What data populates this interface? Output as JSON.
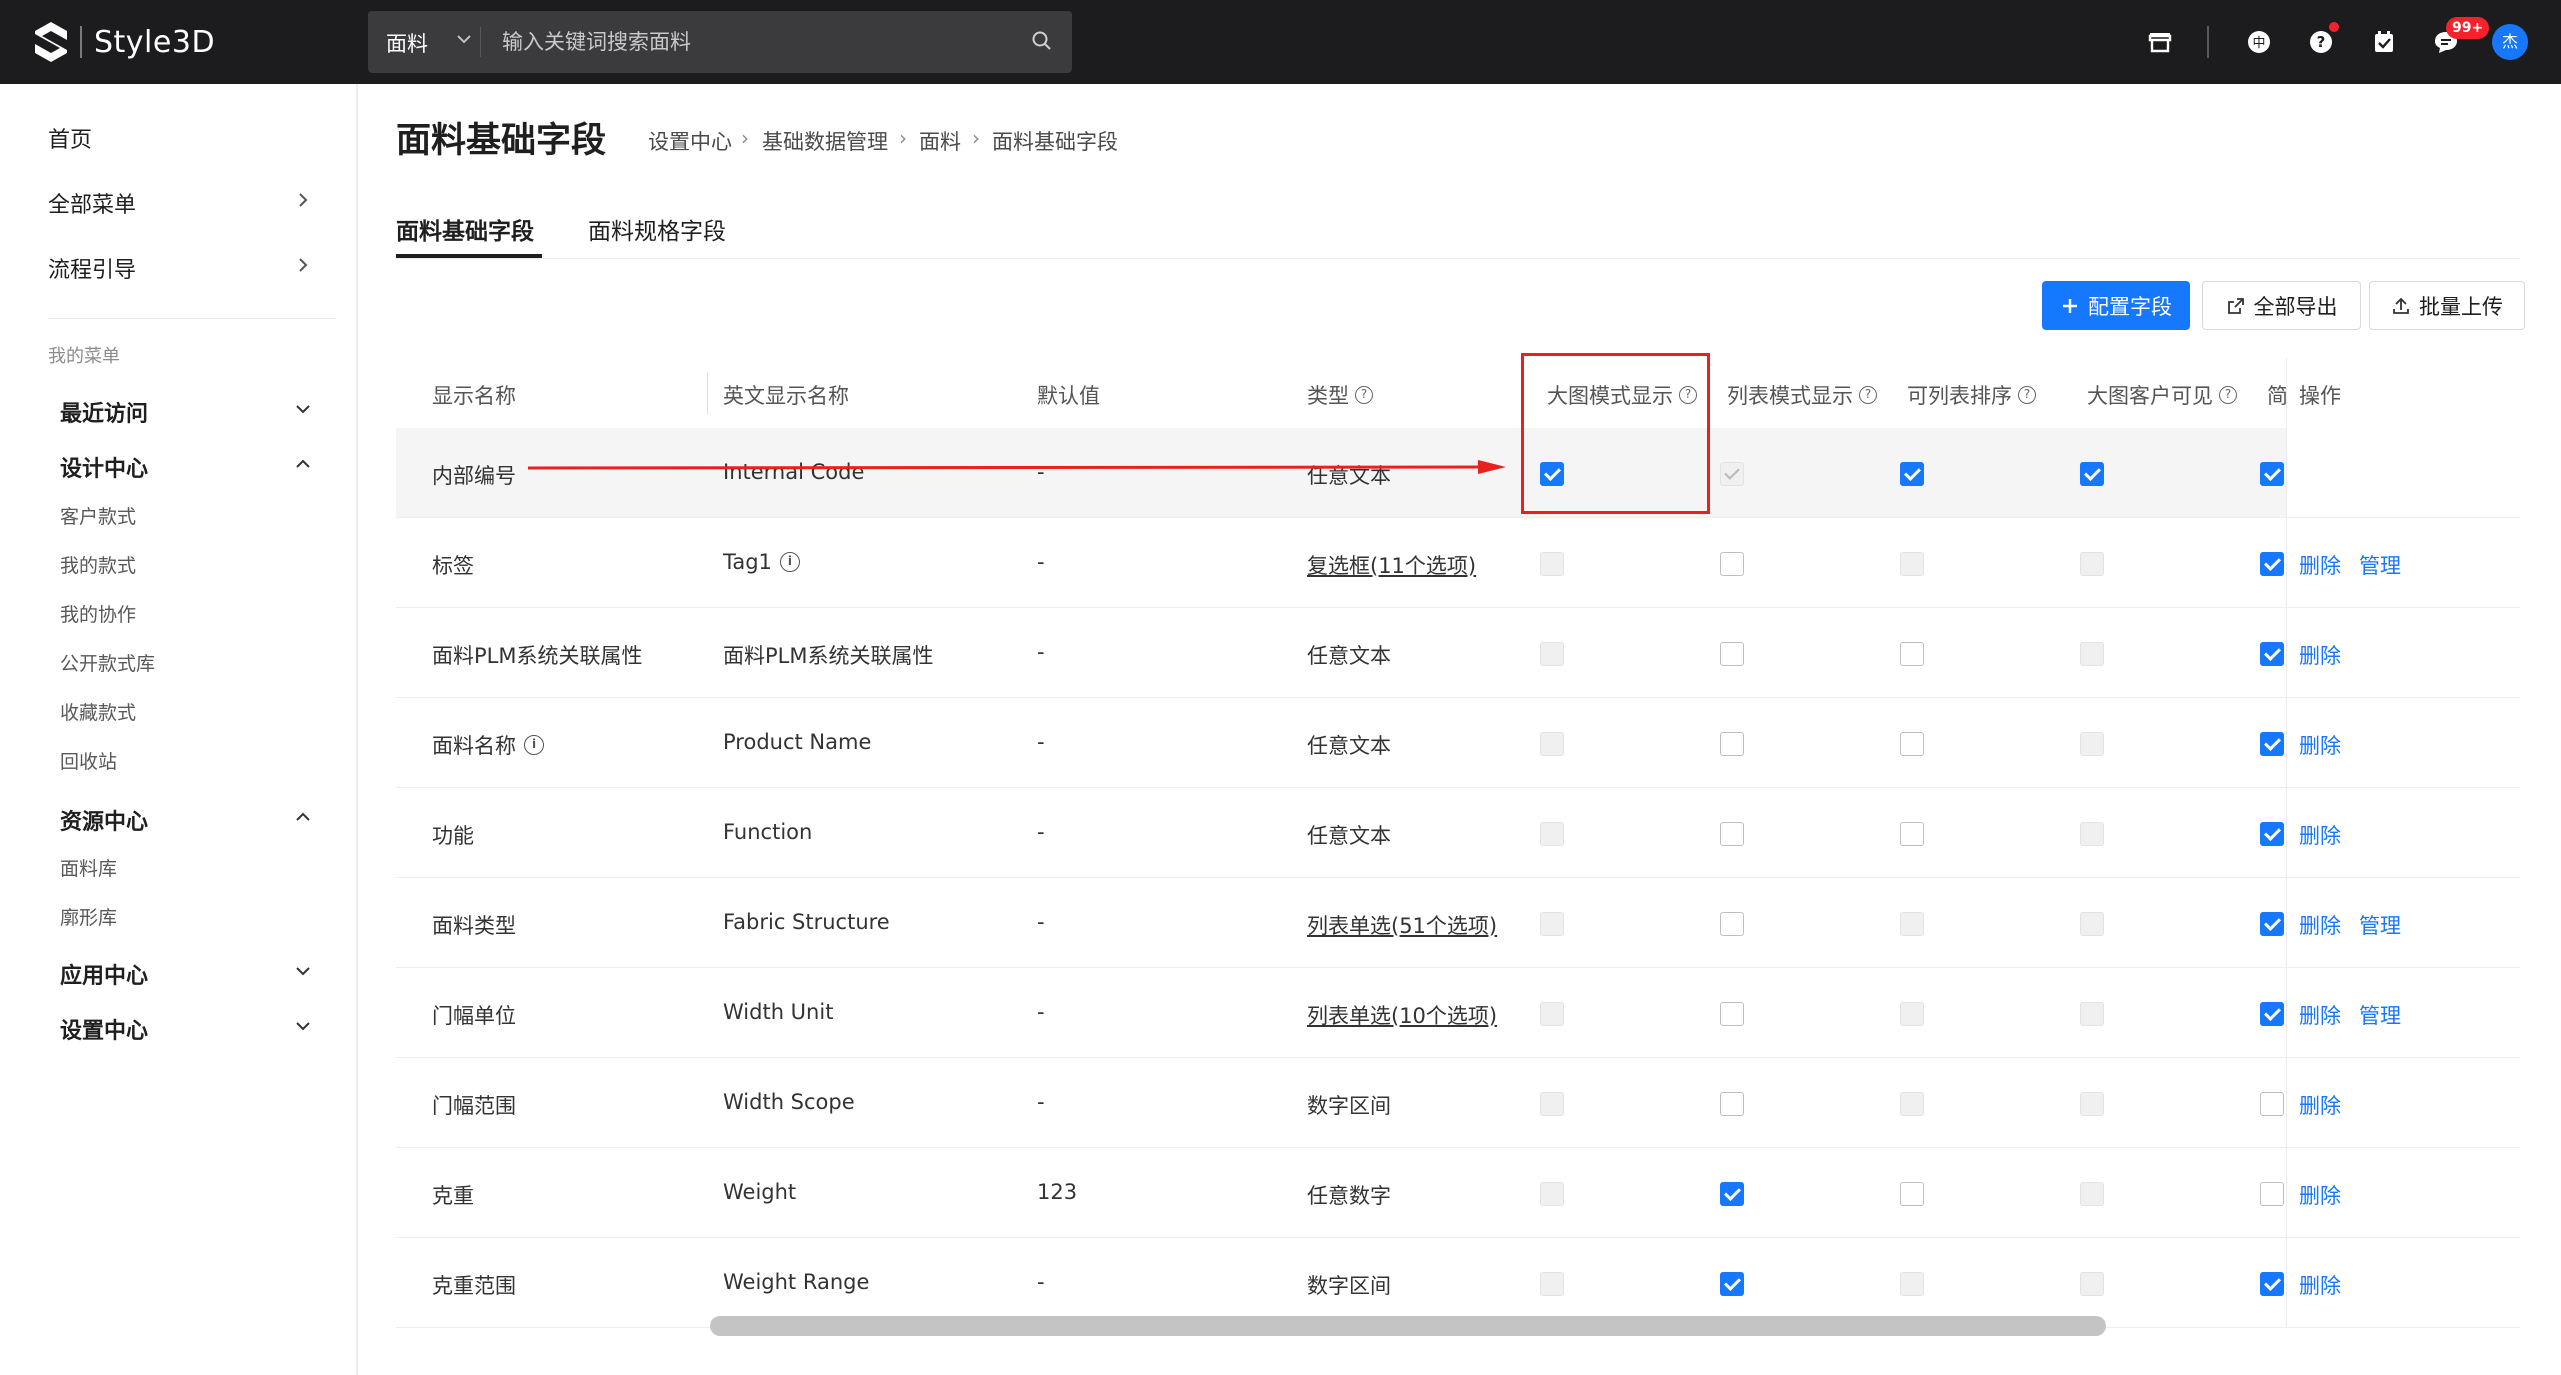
{
  "app": {
    "brand": "Style3D"
  },
  "search": {
    "category": "面料",
    "placeholder": "输入关键词搜索面料"
  },
  "header_icons": [
    "store-icon",
    "language-icon",
    "help-icon",
    "task-icon",
    "message-icon"
  ],
  "notifications": {
    "badge": "99+"
  },
  "user": {
    "avatar_text": "杰"
  },
  "sidebar": {
    "top": [
      {
        "label": "首页",
        "arrow": false
      },
      {
        "label": "全部菜单",
        "arrow": true
      },
      {
        "label": "流程引导",
        "arrow": true
      }
    ],
    "my_menu_caption": "我的菜单",
    "groups": {
      "recent": {
        "label": "最近访问"
      },
      "design": {
        "label": "设计中心",
        "items": [
          "客户款式",
          "我的款式",
          "我的协作",
          "公开款式库",
          "收藏款式",
          "回收站"
        ]
      },
      "resource": {
        "label": "资源中心",
        "items": [
          "面料库",
          "廓形库"
        ]
      },
      "apps": {
        "label": "应用中心"
      },
      "settings": {
        "label": "设置中心"
      }
    }
  },
  "page": {
    "title": "面料基础字段",
    "breadcrumb": [
      "设置中心",
      "基础数据管理",
      "面料",
      "面料基础字段"
    ],
    "tabs": [
      "面料基础字段",
      "面料规格字段"
    ]
  },
  "toolbar": {
    "config": "配置字段",
    "export": "全部导出",
    "upload": "批量上传"
  },
  "table": {
    "headers": {
      "name": "显示名称",
      "en_name": "英文显示名称",
      "default": "默认值",
      "type": "类型",
      "big_image": "大图模式显示",
      "list_mode": "列表模式显示",
      "sortable": "可列表排序",
      "client_visible": "大图客户可见",
      "truncated": "简",
      "ops": "操作"
    },
    "rows": [
      {
        "name": "内部编号",
        "en": "Internal Code",
        "default": "-",
        "type": "任意文本",
        "big": "on",
        "list": "dison",
        "sort": "on",
        "client": "on",
        "trunc": "on",
        "delete": "",
        "manage": ""
      },
      {
        "name": "标签",
        "en": "Tag1",
        "default": "-",
        "type": "复选框(11个选项)",
        "big": "dis",
        "list": "off",
        "sort": "dis",
        "client": "dis",
        "trunc": "on",
        "delete": "删除",
        "manage": "管理"
      },
      {
        "name": "面料PLM系统关联属性",
        "en": "面料PLM系统关联属性",
        "default": "-",
        "type": "任意文本",
        "big": "dis",
        "list": "off",
        "sort": "off",
        "client": "dis",
        "trunc": "on",
        "delete": "删除",
        "manage": ""
      },
      {
        "name": "面料名称",
        "en": "Product Name",
        "default": "-",
        "type": "任意文本",
        "big": "dis",
        "list": "off",
        "sort": "off",
        "client": "dis",
        "trunc": "on",
        "delete": "删除",
        "manage": ""
      },
      {
        "name": "功能",
        "en": "Function",
        "default": "-",
        "type": "任意文本",
        "big": "dis",
        "list": "off",
        "sort": "off",
        "client": "dis",
        "trunc": "on",
        "delete": "删除",
        "manage": ""
      },
      {
        "name": "面料类型",
        "en": "Fabric Structure",
        "default": "-",
        "type": "列表单选(51个选项)",
        "big": "dis",
        "list": "off",
        "sort": "dis",
        "client": "dis",
        "trunc": "on",
        "delete": "删除",
        "manage": "管理"
      },
      {
        "name": "门幅单位",
        "en": "Width Unit",
        "default": "-",
        "type": "列表单选(10个选项)",
        "big": "dis",
        "list": "off",
        "sort": "dis",
        "client": "dis",
        "trunc": "on",
        "delete": "删除",
        "manage": "管理"
      },
      {
        "name": "门幅范围",
        "en": "Width Scope",
        "default": "-",
        "type": "数字区间",
        "big": "dis",
        "list": "off",
        "sort": "dis",
        "client": "dis",
        "trunc": "off",
        "delete": "删除",
        "manage": ""
      },
      {
        "name": "克重",
        "en": "Weight",
        "default": "123",
        "type": "任意数字",
        "big": "dis",
        "list": "on",
        "sort": "off",
        "client": "dis",
        "trunc": "off",
        "delete": "删除",
        "manage": ""
      },
      {
        "name": "克重范围",
        "en": "Weight Range",
        "default": "-",
        "type": "数字区间",
        "big": "dis",
        "list": "on",
        "sort": "dis",
        "client": "dis",
        "trunc": "on",
        "delete": "删除",
        "manage": ""
      }
    ]
  }
}
